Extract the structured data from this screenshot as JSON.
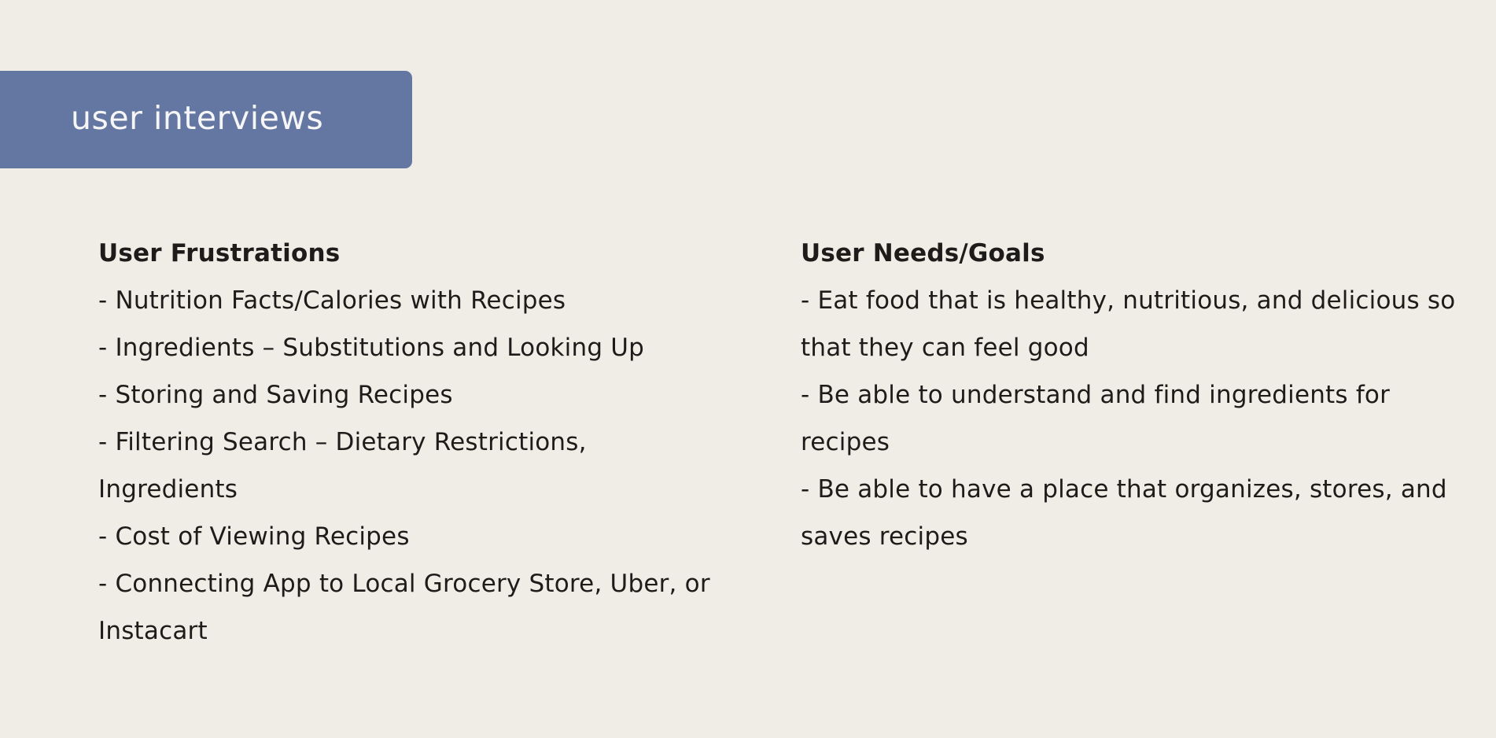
{
  "slide": {
    "title": "user interviews"
  },
  "frustrations": {
    "heading": "User Frustrations",
    "items": [
      "- Nutrition Facts/Calories with Recipes",
      "- Ingredients – Substitutions and Looking Up",
      "- Storing and Saving Recipes",
      "- Filtering Search – Dietary Restrictions, Ingredients",
      "- Cost of Viewing Recipes",
      "- Connecting App to Local Grocery Store, Uber, or Instacart"
    ]
  },
  "needs": {
    "heading": "User Needs/Goals",
    "items": [
      "- Eat food that is healthy, nutritious, and delicious so that they can feel good",
      "- Be able to understand and find ingredients for recipes",
      "- Be able to have a place that organizes, stores, and saves recipes"
    ]
  },
  "colors": {
    "background": "#f0ede6",
    "banner": "#6477a3",
    "banner_text": "#f6f6f6",
    "body_text": "#1e1c1a"
  }
}
